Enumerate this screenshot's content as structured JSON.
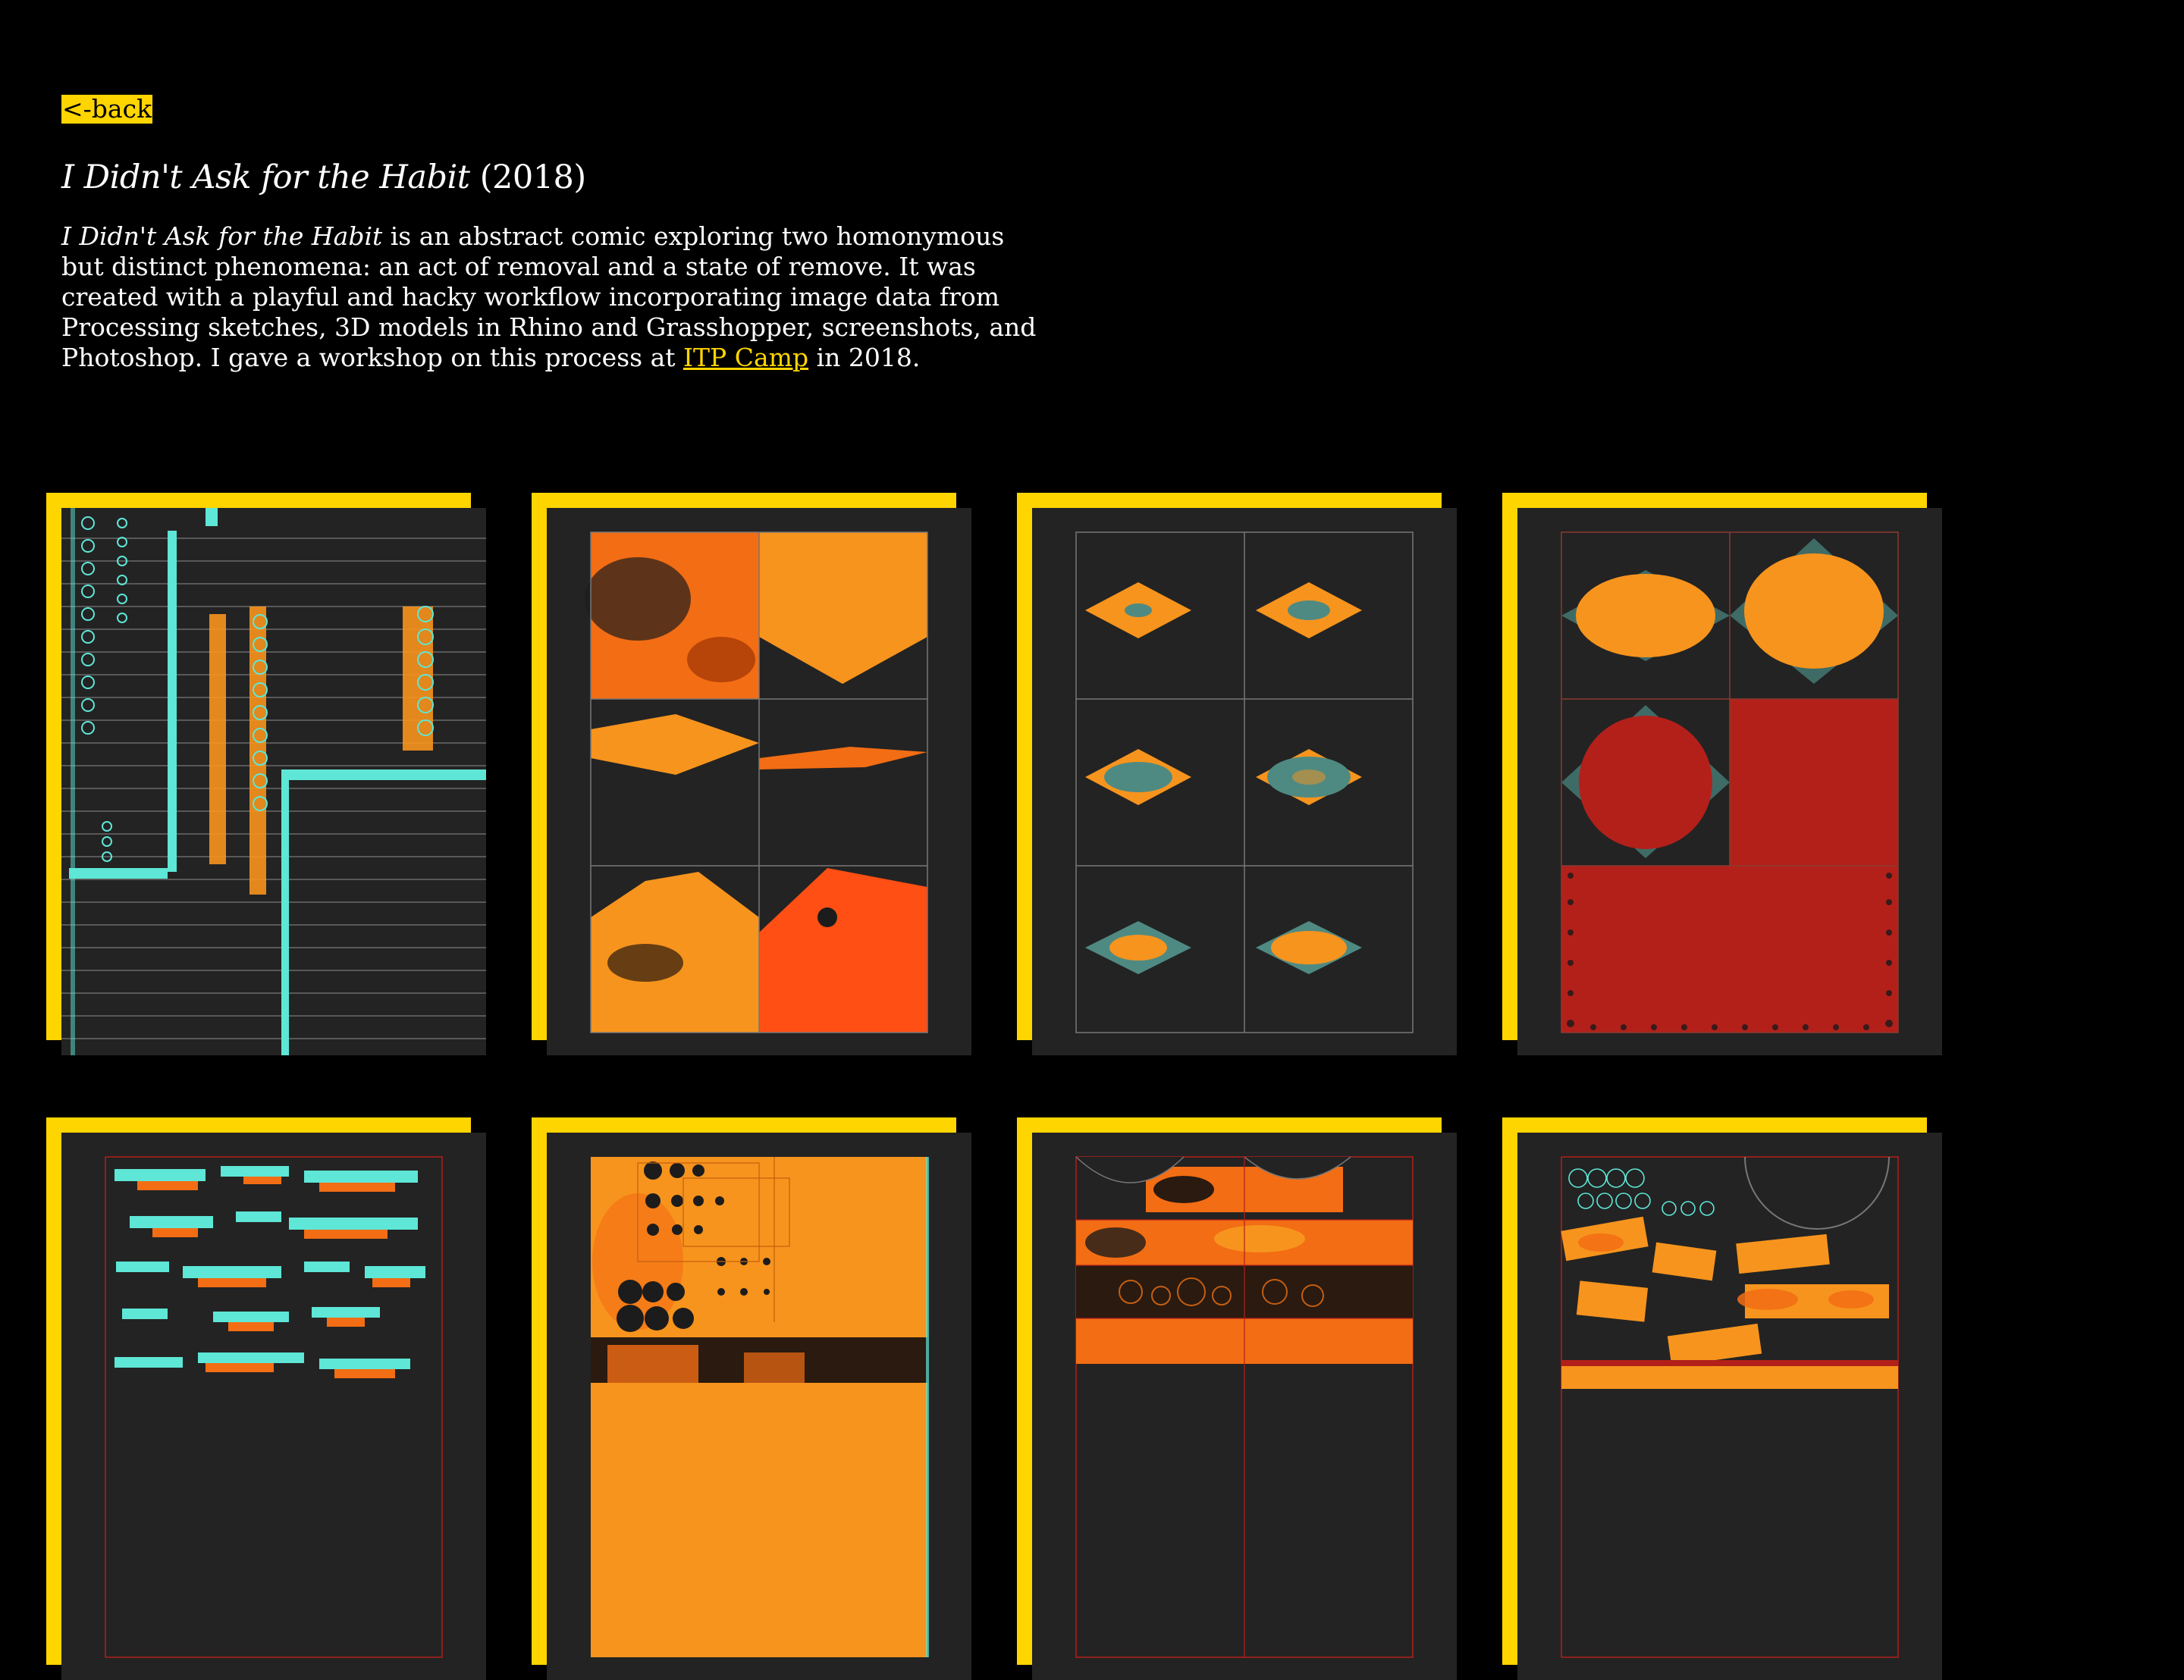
{
  "nav": {
    "back_label": "<-back"
  },
  "project": {
    "title": "I Didn't Ask for the Habit",
    "year": "(2018)"
  },
  "description": {
    "title_ref": "I Didn't Ask for the Habit",
    "body": " is an abstract comic exploring two homonymous but distinct phenomena: an act of removal and a state of remove. It was created with a playful and hacky workflow incorporating image data from Processing sketches, 3D models in Rhino and Grasshopper, screenshots, and Photoshop. I gave a workshop on this process at ",
    "link_text": "ITP Camp",
    "tail": " in 2018."
  },
  "gallery": {
    "items": [
      {
        "icon": "comic-page-1-image"
      },
      {
        "icon": "comic-page-2-image"
      },
      {
        "icon": "comic-page-3-image"
      },
      {
        "icon": "comic-page-4-image"
      },
      {
        "icon": "comic-page-5-image"
      },
      {
        "icon": "comic-page-6-image"
      },
      {
        "icon": "comic-page-7-image"
      },
      {
        "icon": "comic-page-8-image"
      }
    ]
  },
  "colors": {
    "accent": "#ffd500",
    "background": "#000000",
    "panel": "#232323",
    "orange": "#f7941d",
    "red": "#b3201a",
    "cyan": "#5ee6d6"
  }
}
